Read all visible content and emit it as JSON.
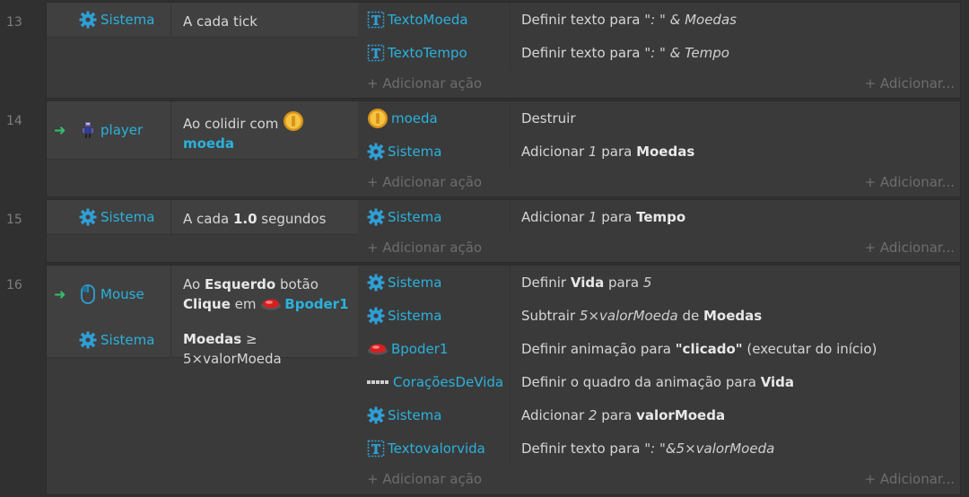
{
  "add_action": "+ Adicionar ação",
  "add_action_right": "+ Adicionar...",
  "events": [
    {
      "number": "13",
      "conditions": [
        {
          "object": "Sistema",
          "icon": "gear-icon",
          "text": [
            "A cada tick"
          ]
        }
      ],
      "actions": [
        {
          "object": "TextoMoeda",
          "icon": "text-object-icon",
          "parts": [
            "Definir texto para ",
            "\": \" & Moedas"
          ]
        },
        {
          "object": "TextoTempo",
          "icon": "text-object-icon",
          "parts": [
            "Definir texto para ",
            "\": \" & Tempo"
          ]
        }
      ]
    },
    {
      "number": "14",
      "conditions": [
        {
          "object": "player",
          "icon": "player-sprite-icon",
          "text": [
            "Ao colidir com",
            "moeda"
          ]
        }
      ],
      "actions": [
        {
          "object": "moeda",
          "icon": "coin-icon",
          "parts": [
            "Destruir"
          ]
        },
        {
          "object": "Sistema",
          "icon": "gear-icon",
          "parts": [
            "Adicionar ",
            "1",
            " para ",
            "Moedas"
          ]
        }
      ]
    },
    {
      "number": "15",
      "conditions": [
        {
          "object": "Sistema",
          "icon": "gear-icon",
          "text": [
            "A cada ",
            "1.0",
            " segundos"
          ]
        }
      ],
      "actions": [
        {
          "object": "Sistema",
          "icon": "gear-icon",
          "parts": [
            "Adicionar ",
            "1",
            " para ",
            "Tempo"
          ]
        }
      ]
    },
    {
      "number": "16",
      "conditions": [
        {
          "object": "Mouse",
          "icon": "mouse-icon",
          "text": [
            "Ao ",
            "Esquerdo",
            " botão",
            "Clique",
            " em ",
            "Bpoder1"
          ]
        },
        {
          "object": "Sistema",
          "icon": "gear-icon",
          "text": [
            "Moedas",
            " ≥ 5×valorMoeda"
          ]
        }
      ],
      "actions": [
        {
          "object": "Sistema",
          "icon": "gear-icon",
          "parts": [
            "Definir ",
            "Vida",
            " para ",
            "5"
          ]
        },
        {
          "object": "Sistema",
          "icon": "gear-icon",
          "parts": [
            "Subtrair ",
            "5×valorMoeda",
            " de ",
            "Moedas"
          ]
        },
        {
          "object": "Bpoder1",
          "icon": "red-button-icon",
          "parts": [
            "Definir animação para ",
            "\"clicado\"",
            " (executar do início)"
          ]
        },
        {
          "object": "CoraçõesDeVida",
          "icon": "hearts-strip-icon",
          "parts": [
            "Definir o quadro da animação para ",
            "Vida"
          ]
        },
        {
          "object": "Sistema",
          "icon": "gear-icon",
          "parts": [
            "Adicionar ",
            "2",
            " para ",
            "valorMoeda"
          ]
        },
        {
          "object": "Textovalorvida",
          "icon": "text-object-icon",
          "parts": [
            "Definir texto para ",
            "\": \"&5×valorMoeda"
          ]
        }
      ]
    }
  ]
}
